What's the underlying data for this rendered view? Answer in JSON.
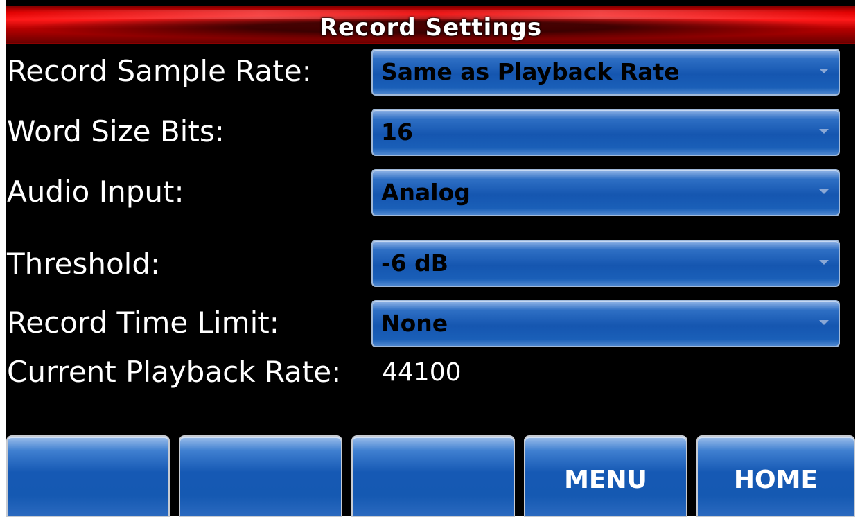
{
  "header": {
    "title": "Record Settings"
  },
  "settings": [
    {
      "label": "Record Sample Rate:",
      "value": "Same as Playback Rate"
    },
    {
      "label": "Word Size Bits:",
      "value": "16"
    },
    {
      "label": "Audio Input:",
      "value": "Analog"
    },
    {
      "label": "Threshold:",
      "value": "-6 dB"
    },
    {
      "label": "Record Time Limit:",
      "value": "None"
    }
  ],
  "info": {
    "label": "Current Playback Rate:",
    "value": "44100"
  },
  "footer": {
    "buttons": [
      {
        "label": ""
      },
      {
        "label": ""
      },
      {
        "label": ""
      },
      {
        "label": "MENU"
      },
      {
        "label": "HOME"
      }
    ]
  },
  "colors": {
    "titlebar_red": "#e00000",
    "dropdown_blue": "#1556b0",
    "background": "#000000",
    "text": "#ffffff"
  },
  "icons": {
    "dropdown_indicator": "chevron-down-icon"
  }
}
